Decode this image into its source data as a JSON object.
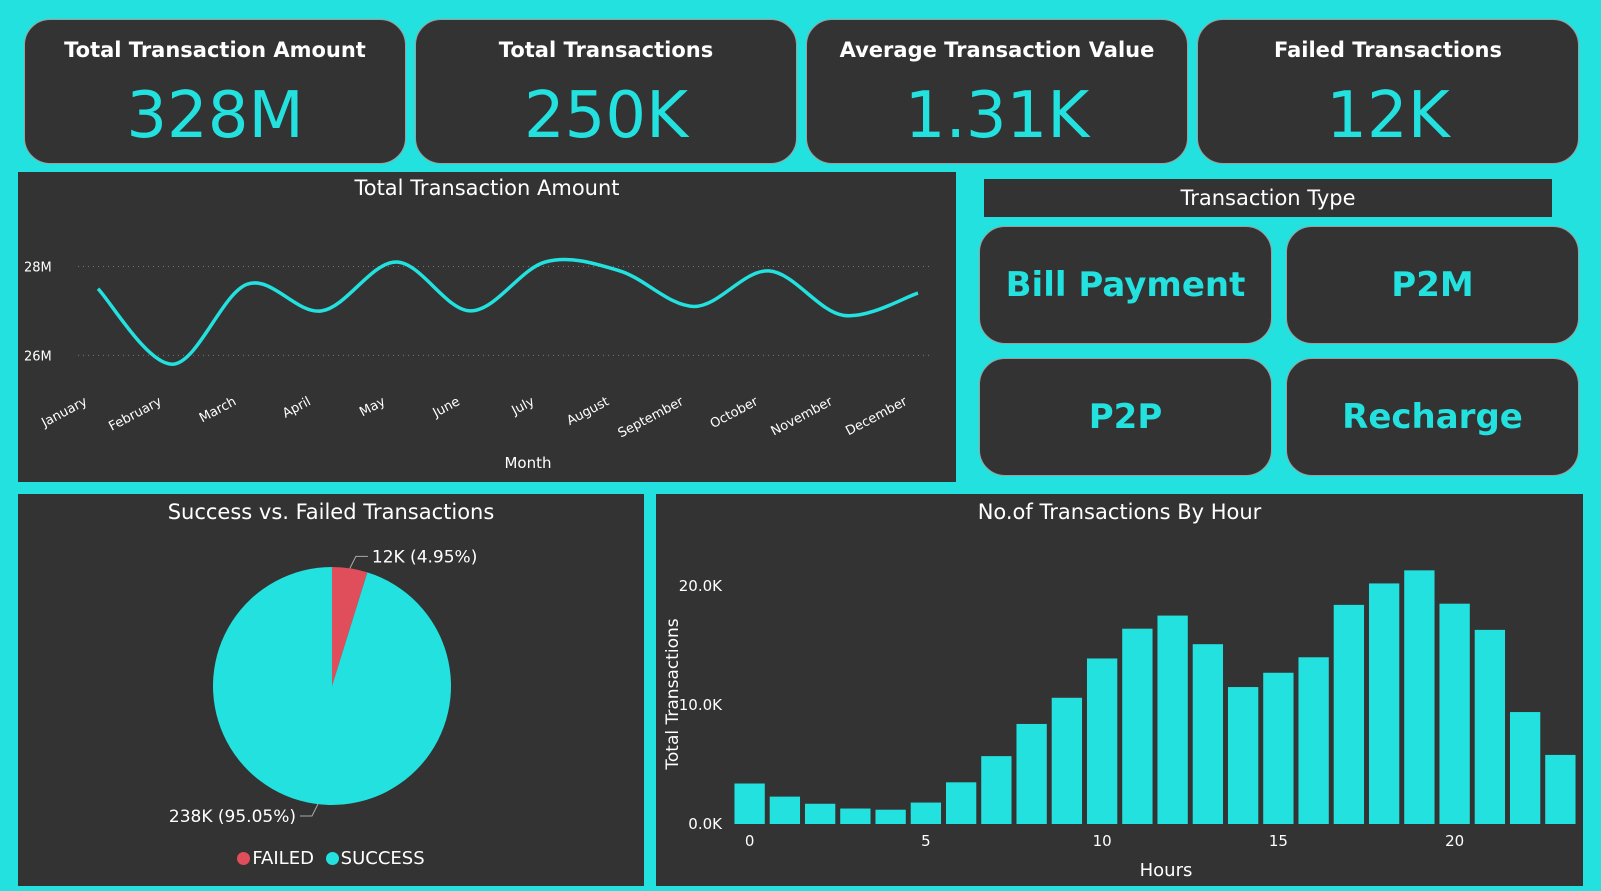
{
  "kpis": [
    {
      "label": "Total Transaction Amount",
      "value": "328M"
    },
    {
      "label": "Total Transactions",
      "value": "250K"
    },
    {
      "label": "Average Transaction Value",
      "value": "1.31K"
    },
    {
      "label": "Failed Transactions",
      "value": "12K"
    }
  ],
  "transaction_type": {
    "header": "Transaction Type",
    "tiles": [
      "Bill Payment",
      "P2M",
      "P2P",
      "Recharge"
    ]
  },
  "colors": {
    "accent": "#22e1de",
    "panel": "#333333",
    "failed": "#e04e5c",
    "text": "#ffffff"
  },
  "chart_data": [
    {
      "type": "line",
      "title": "Total Transaction Amount",
      "xlabel": "Month",
      "ylabel": "",
      "categories": [
        "January",
        "February",
        "March",
        "April",
        "May",
        "June",
        "July",
        "August",
        "September",
        "October",
        "November",
        "December"
      ],
      "values": [
        27.5,
        25.8,
        27.6,
        27.0,
        28.1,
        27.0,
        28.1,
        27.9,
        27.1,
        27.9,
        26.9,
        27.4
      ],
      "yticks": [
        {
          "v": 26,
          "label": "26M"
        },
        {
          "v": 28,
          "label": "28M"
        }
      ],
      "ylim": [
        25.4,
        29.0
      ],
      "grid": true
    },
    {
      "type": "pie",
      "title": "Success vs. Failed Transactions",
      "slices": [
        {
          "name": "FAILED",
          "value": 12,
          "label": "12K (4.95%)",
          "color": "#e04e5c"
        },
        {
          "name": "SUCCESS",
          "value": 238,
          "label": "238K (95.05%)",
          "color": "#22e1de"
        }
      ],
      "legend": "bottom"
    },
    {
      "type": "bar",
      "title": "No.of Transactions By Hour",
      "xlabel": "Hours",
      "ylabel": "Total Transactions",
      "x": [
        0,
        1,
        2,
        3,
        4,
        5,
        6,
        7,
        8,
        9,
        10,
        11,
        12,
        13,
        14,
        15,
        16,
        17,
        18,
        19,
        20,
        21,
        22,
        23
      ],
      "values": [
        3400,
        2300,
        1700,
        1300,
        1200,
        1800,
        3500,
        5700,
        8400,
        10600,
        13900,
        16400,
        17500,
        15100,
        11500,
        12700,
        14000,
        18400,
        20200,
        21300,
        18500,
        16300,
        9400,
        5800
      ],
      "xticks": [
        0,
        5,
        10,
        15,
        20
      ],
      "yticks": [
        {
          "v": 0,
          "label": "0.0K"
        },
        {
          "v": 10000,
          "label": "10.0K"
        },
        {
          "v": 20000,
          "label": "20.0K"
        }
      ],
      "ylim": [
        0,
        22000
      ]
    }
  ]
}
